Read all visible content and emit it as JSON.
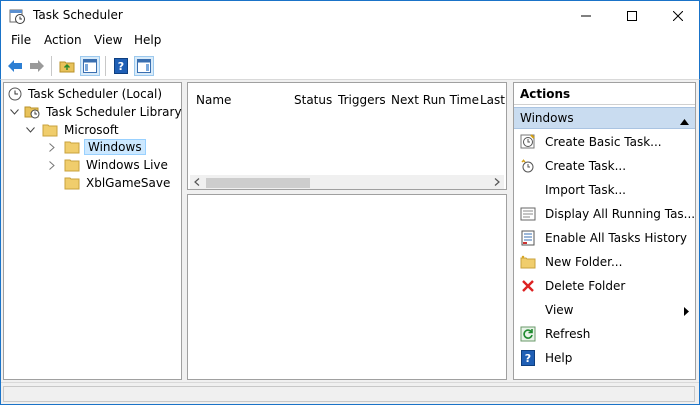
{
  "window": {
    "title": "Task Scheduler",
    "icon": "task-scheduler-icon",
    "accent": "#1a73c8"
  },
  "menu": [
    "File",
    "Action",
    "View",
    "Help"
  ],
  "toolbar": {
    "buttons": [
      "back-arrow-icon",
      "forward-arrow-icon",
      "folder-up-icon",
      "show-hide-console-tree-icon",
      "help-icon",
      "show-hide-action-pane-icon"
    ]
  },
  "tree": {
    "root": "Task Scheduler (Local)",
    "library": "Task Scheduler Library",
    "microsoft": "Microsoft",
    "windows": "Windows",
    "windows_live": "Windows Live",
    "xbl": "XblGameSave"
  },
  "list": {
    "columns": [
      "Name",
      "Status",
      "Triggers",
      "Next Run Time",
      "Last"
    ]
  },
  "actions": {
    "header": "Actions",
    "group": "Windows",
    "items": [
      {
        "label": "Create Basic Task...",
        "icon": "create-basic-task-icon"
      },
      {
        "label": "Create Task...",
        "icon": "create-task-icon"
      },
      {
        "label": "Import Task...",
        "icon": ""
      },
      {
        "label": "Display All Running Tas...",
        "icon": "display-running-tasks-icon"
      },
      {
        "label": "Enable All Tasks History",
        "icon": "tasks-history-icon"
      },
      {
        "label": "New Folder...",
        "icon": "new-folder-icon"
      },
      {
        "label": "Delete Folder",
        "icon": "delete-icon"
      },
      {
        "label": "View",
        "icon": ""
      },
      {
        "label": "Refresh",
        "icon": "refresh-icon"
      },
      {
        "label": "Help",
        "icon": "help-icon"
      }
    ]
  }
}
